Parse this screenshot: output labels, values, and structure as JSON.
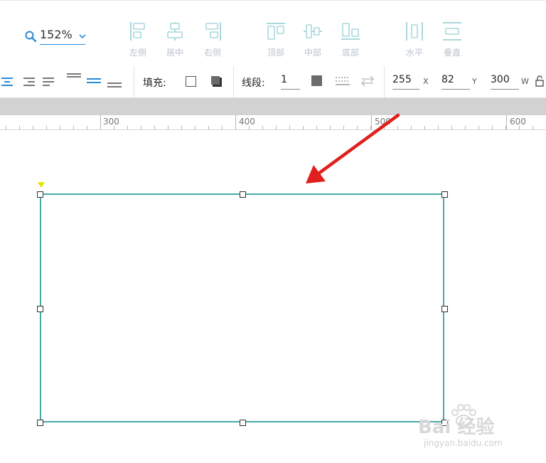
{
  "zoom": {
    "value": "152%",
    "icon": "search-icon"
  },
  "align_group": {
    "left": "左侧",
    "center": "居中",
    "right": "右侧",
    "top": "顶部",
    "middle": "中部",
    "bottom": "底部",
    "horizontal": "水平",
    "vertical": "垂直"
  },
  "format": {
    "fill_label": "填充:",
    "stroke_label": "线段:",
    "stroke_width": "1"
  },
  "position": {
    "x_value": "255",
    "x_label": "X",
    "y_value": "82",
    "y_label": "Y",
    "w_value": "300",
    "w_label": "W"
  },
  "ruler": {
    "labels": [
      "300",
      "400",
      "500",
      "600"
    ]
  },
  "watermark": {
    "text": "Bai 经验",
    "url": "jingyan.baidu.com"
  },
  "colors": {
    "accent": "#2a8bd6",
    "shape_border": "#4aa9a6",
    "arrow": "#e0201c",
    "icon_muted": "#a9d8dc"
  }
}
